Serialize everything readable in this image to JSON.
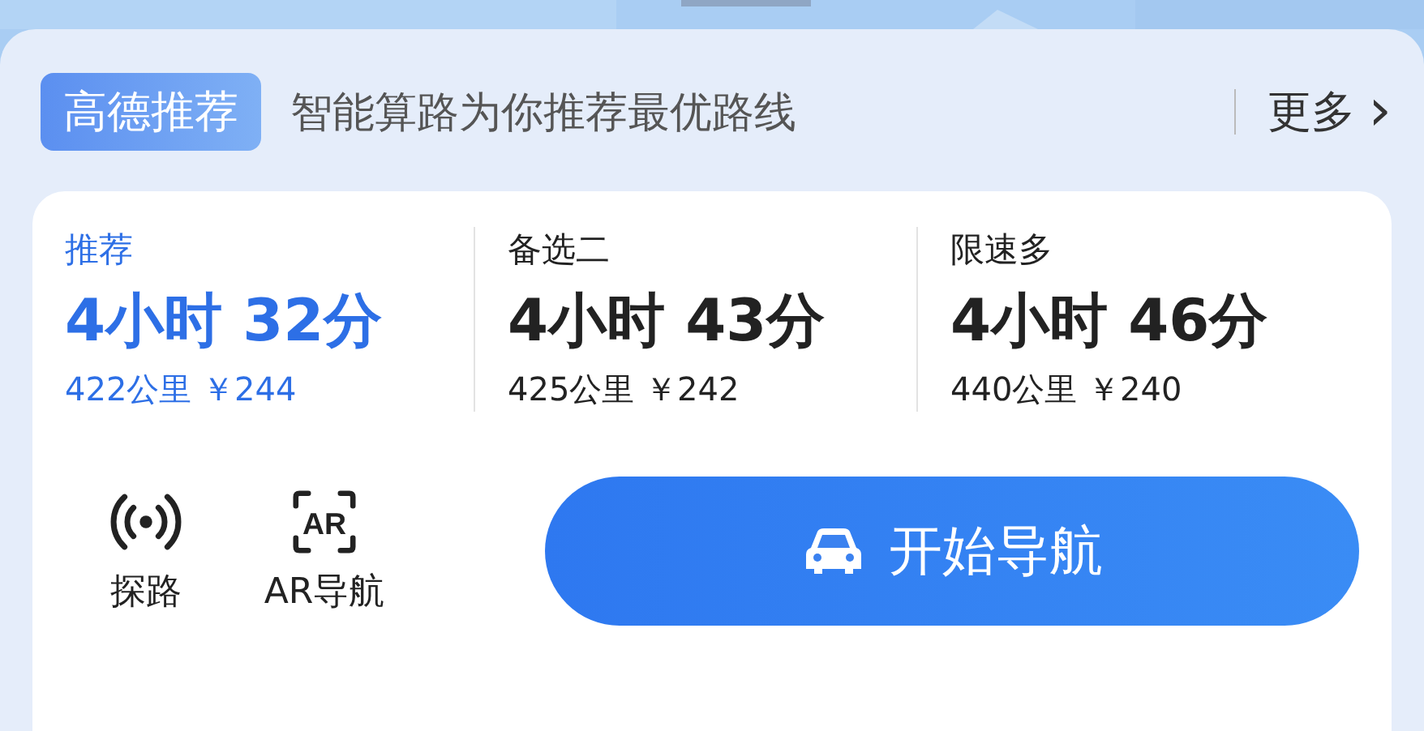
{
  "header": {
    "badge": "高德推荐",
    "subtitle": "智能算路为你推荐最优路线",
    "more": "更多",
    "more_arrow": "›"
  },
  "routes": [
    {
      "label": "推荐",
      "time": "4小时 32分",
      "detail": "422公里 ￥244",
      "selected": true
    },
    {
      "label": "备选二",
      "time": "4小时 43分",
      "detail": "425公里 ￥242",
      "selected": false
    },
    {
      "label": "限速多",
      "time": "4小时 46分",
      "detail": "440公里 ￥240",
      "selected": false
    }
  ],
  "tools": [
    {
      "kind": "signal",
      "label": "探路"
    },
    {
      "kind": "ar",
      "label": "AR导航",
      "icon_text": "AR"
    }
  ],
  "navigate_button": {
    "label": "开始导航"
  }
}
